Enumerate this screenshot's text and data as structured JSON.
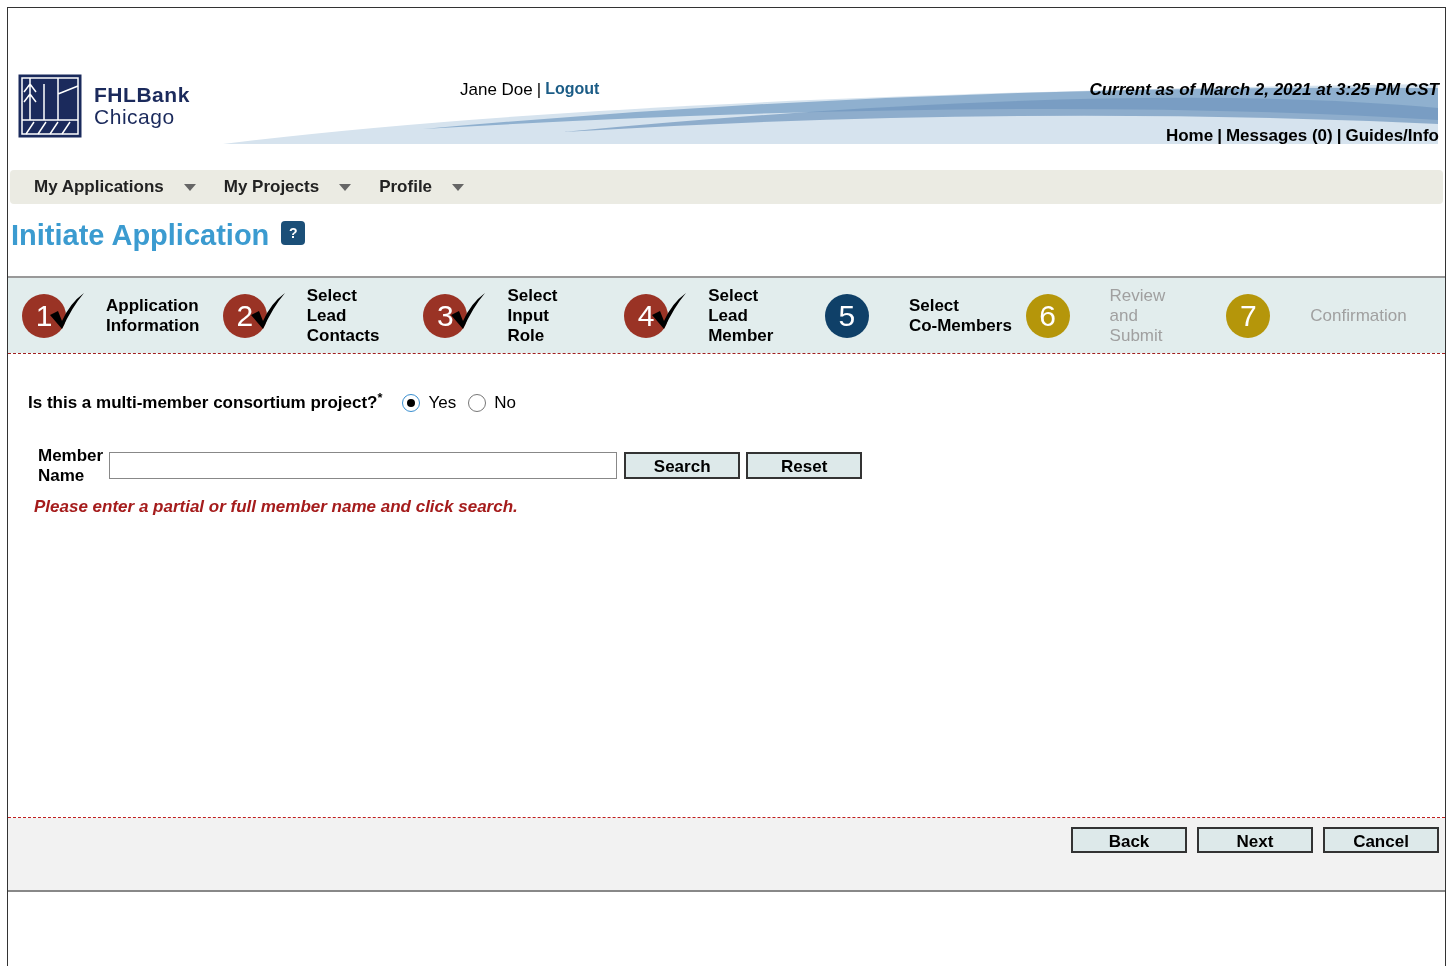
{
  "logo": {
    "line1": "FHLBank",
    "line2": "Chicago"
  },
  "user": {
    "name": "Jane Doe",
    "separator": "|",
    "logout": "Logout"
  },
  "timestamp": "Current as of March 2, 2021 at 3:25 PM CST",
  "header_links": {
    "separator": "|",
    "items": [
      "Home",
      "Messages (0)",
      "Guides/Info"
    ]
  },
  "menu": [
    {
      "label": "My Applications"
    },
    {
      "label": "My Projects"
    },
    {
      "label": "Profile"
    }
  ],
  "page_title": "Initiate Application",
  "help_icon": "?",
  "steps": [
    {
      "number": "1",
      "kind": "done",
      "lines": [
        "Application",
        "Information"
      ]
    },
    {
      "number": "2",
      "kind": "done",
      "lines": [
        "Select",
        "Lead",
        "Contacts"
      ]
    },
    {
      "number": "3",
      "kind": "done",
      "lines": [
        "Select",
        "Input",
        "Role"
      ]
    },
    {
      "number": "4",
      "kind": "done",
      "lines": [
        "Select",
        "Lead",
        "Member"
      ]
    },
    {
      "number": "5",
      "kind": "current",
      "lines": [
        "Select",
        "Co-Members"
      ]
    },
    {
      "number": "6",
      "kind": "todo",
      "lines": [
        "Review",
        "and",
        "Submit"
      ]
    },
    {
      "number": "7",
      "kind": "todo",
      "lines": [
        "Confirmation"
      ]
    }
  ],
  "question": {
    "text": "Is this a multi-member consortium project?$^{*}$",
    "options": [
      {
        "label": "Yes",
        "selected": true
      },
      {
        "label": "No",
        "selected": false
      }
    ]
  },
  "member_search": {
    "label": [
      "Member",
      "Name"
    ],
    "buttons": [
      "Search",
      "Reset"
    ],
    "hint": "Please enter a partial or full member name and click search."
  },
  "footer_buttons": [
    "Back",
    "Next",
    "Cancel"
  ]
}
